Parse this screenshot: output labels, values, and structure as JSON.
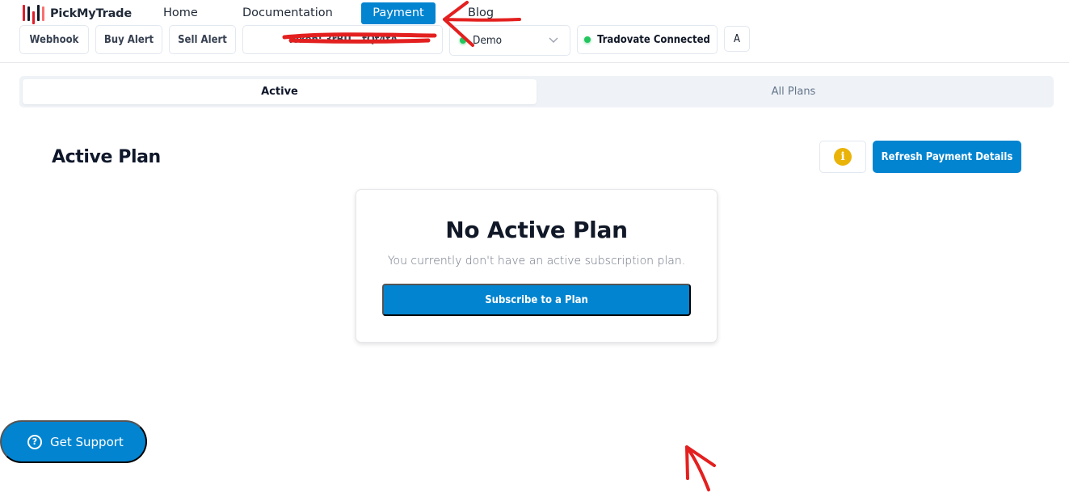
{
  "brand": {
    "name": "PickMyTrade"
  },
  "nav": {
    "items": [
      {
        "label": "Home",
        "active": false
      },
      {
        "label": "Documentation",
        "active": false
      },
      {
        "label": "Payment",
        "active": true
      },
      {
        "label": "Blog",
        "active": false
      }
    ]
  },
  "toolbar": {
    "webhook_label": "Webhook",
    "buy_alert_label": "Buy Alert",
    "sell_alert_label": "Sell Alert",
    "token_label": "Token: 3rBU...tQt4tA",
    "account_select": {
      "selected": "Demo",
      "status_color": "#22c55e"
    },
    "connection_status": {
      "label": "Tradovate Connected",
      "status_color": "#22c55e"
    },
    "avatar_initial": "A"
  },
  "tabs": [
    {
      "label": "Active",
      "active": true
    },
    {
      "label": "All Plans",
      "active": false
    }
  ],
  "main": {
    "section_title": "Active Plan",
    "info_icon": "info-icon",
    "refresh_label": "Refresh Payment Details",
    "card": {
      "title": "No Active Plan",
      "subtitle": "You currently don't have an active subscription plan.",
      "cta_label": "Subscribe to a Plan"
    }
  },
  "support": {
    "label": "Get Support",
    "icon": "question-circle-icon"
  },
  "colors": {
    "primary": "#0284d0",
    "info": "#eab308",
    "success": "#22c55e",
    "annotation": "#e3201f"
  }
}
